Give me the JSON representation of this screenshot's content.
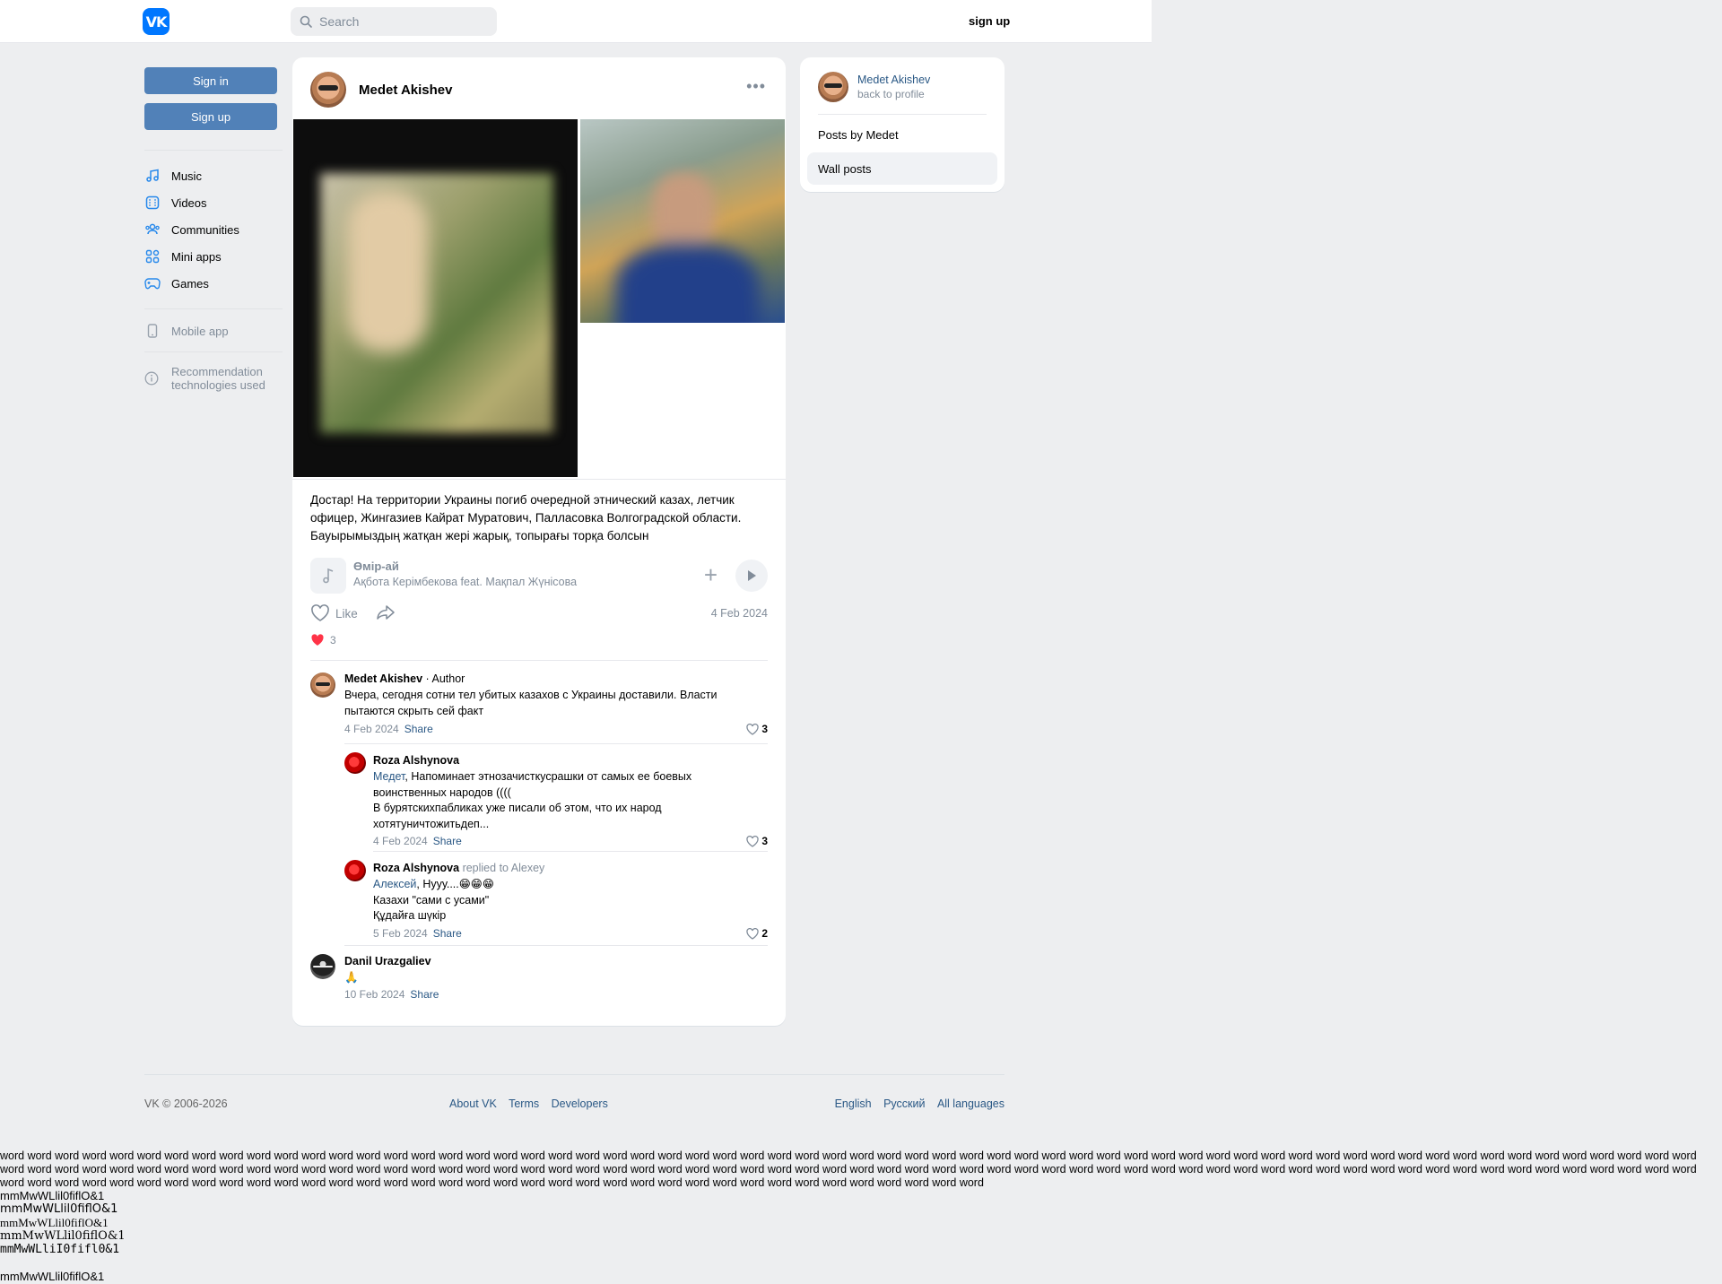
{
  "header": {
    "logo_text": "VK",
    "search_placeholder": "Search",
    "signup_label": "sign up"
  },
  "sidebar": {
    "signin_label": "Sign in",
    "signup_label": "Sign up",
    "items": [
      {
        "label": "Music",
        "icon": "music-icon"
      },
      {
        "label": "Videos",
        "icon": "video-icon"
      },
      {
        "label": "Communities",
        "icon": "communities-icon"
      },
      {
        "label": "Mini apps",
        "icon": "mini-apps-icon"
      },
      {
        "label": "Games",
        "icon": "gamepad-icon"
      }
    ],
    "mobile_app_label": "Mobile app",
    "recommendation_line1": "Recommendation",
    "recommendation_line2": "technologies used"
  },
  "post": {
    "author": "Medet Akishev",
    "text": "Достар! На территории Украины погиб очередной этнический казах, летчик офицер, Жингазиев Кайрат Муратович, Палласовка Волгоградской области. Бауырымыздың жатқан жері жарық, топырағы торқа болсын",
    "audio": {
      "title": "Өмір-ай",
      "artist": "Ақбота Керімбекова feat. Мақпал Жүнісова"
    },
    "like_label": "Like",
    "date": "4 Feb 2024",
    "reactions_count": "3"
  },
  "comments": [
    {
      "name": "Medet Akishev",
      "role": " · Author",
      "text_line1": "Вчера, сегодня сотни тел убитых казахов с Украины доставили. Власти",
      "text_line2": "пытаются скрыть сей факт",
      "date": "4 Feb 2024",
      "share": "Share",
      "likes": "3"
    },
    {
      "name": "Roza Alshynova",
      "mention": "Медет",
      "text_line1": ", Напоминает этнозачисткусрашки от самых ее боевых",
      "text_line2": "воинственных народов ((((",
      "text_line3": "В бурятскихпабликах уже писали об этом, что их народ",
      "text_line4": "хотятуничтожитьдеп...",
      "date": "4 Feb 2024",
      "share": "Share",
      "likes": "3"
    },
    {
      "name": "Roza Alshynova",
      "replied": " replied to Alexey",
      "mention": "Алексей",
      "text_line1": ", Нууу....😁😁😁",
      "text_line2": "Казахи \"сами с усами\"",
      "text_line3": "Құдайға шүкір",
      "date": "5 Feb 2024",
      "share": "Share",
      "likes": "2"
    },
    {
      "name": "Danil Urazgaliev",
      "text_line1": "🙏",
      "date": "10 Feb 2024",
      "share": "Share"
    }
  ],
  "right_panel": {
    "profile_name": "Medet Akishev",
    "profile_sub": "back to profile",
    "items": [
      "Posts by Medet",
      "Wall posts"
    ]
  },
  "footer": {
    "copyright": "VK © 2006-2026",
    "links": [
      "About VK",
      "Terms",
      "Developers"
    ],
    "languages": [
      "English",
      "Русский",
      "All languages"
    ]
  },
  "filler": {
    "word_line": "word word word word word word word word word word word word word word word word word word word word word word word word word word word word word word word word word word word word word word word word word word word word word word word word word word word word word word word word word word word word word word word word word word word word word word word word word word word word word word word word word word word word word word word word word word word word word word word word word word word word word word word word word word word word word word word word word word word word word word word word word word word word word word word word word word word word word word word word word word word word word word word word word word word word word word word word word word word word word word word word",
    "font_samples": [
      "mmMwWLlil0fiflO&1",
      "mmMwWLlil0fiflO&1",
      "mmMwWLlil0fiflO&1",
      "mmMwWLlil0fiflO&1",
      "mmMwWLliI0fifl0&1",
      "mmMwWLlil0fiflO&1"
    ]
  }
}
